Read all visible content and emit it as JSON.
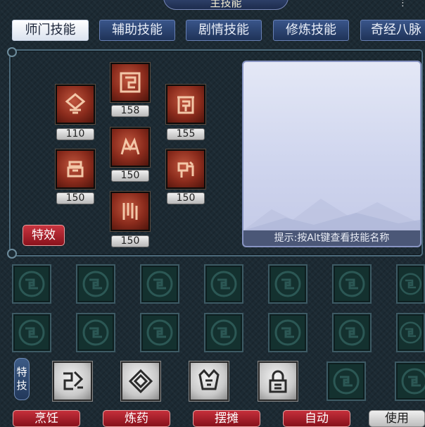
{
  "window": {
    "title": "主技能",
    "menu_icon": "more-icon"
  },
  "tabs": [
    {
      "label": "师门技能",
      "active": true
    },
    {
      "label": "辅助技能",
      "active": false
    },
    {
      "label": "剧情技能",
      "active": false
    },
    {
      "label": "修炼技能",
      "active": false
    },
    {
      "label": "奇经八脉",
      "active": false
    }
  ],
  "skills": [
    {
      "level": "110",
      "icon": "rune-skill-1-icon"
    },
    {
      "level": "158",
      "icon": "rune-skill-2-icon"
    },
    {
      "level": "155",
      "icon": "rune-skill-3-icon"
    },
    {
      "level": "150",
      "icon": "rune-skill-4-icon"
    },
    {
      "level": "150",
      "icon": "rune-skill-5-icon"
    },
    {
      "level": "150",
      "icon": "rune-skill-6-icon"
    },
    {
      "level": "150",
      "icon": "rune-skill-7-icon"
    }
  ],
  "effect_button": "特效",
  "info_panel": {
    "hint": "提示:按Alt键查看技能名称"
  },
  "special_skills": {
    "label_line1": "特",
    "label_line2": "技",
    "items": [
      "special-skill-1-icon",
      "special-skill-2-icon",
      "special-skill-3-icon",
      "special-skill-4-icon"
    ]
  },
  "bottom_buttons": [
    "烹饪",
    "炼药",
    "摆摊",
    "自动",
    "使用"
  ],
  "colors": {
    "skill_red": "#8a2b1c",
    "button_red": "#c52f3b",
    "slot_teal": "#14312f",
    "panel_lavender": "#cfd5ee"
  }
}
